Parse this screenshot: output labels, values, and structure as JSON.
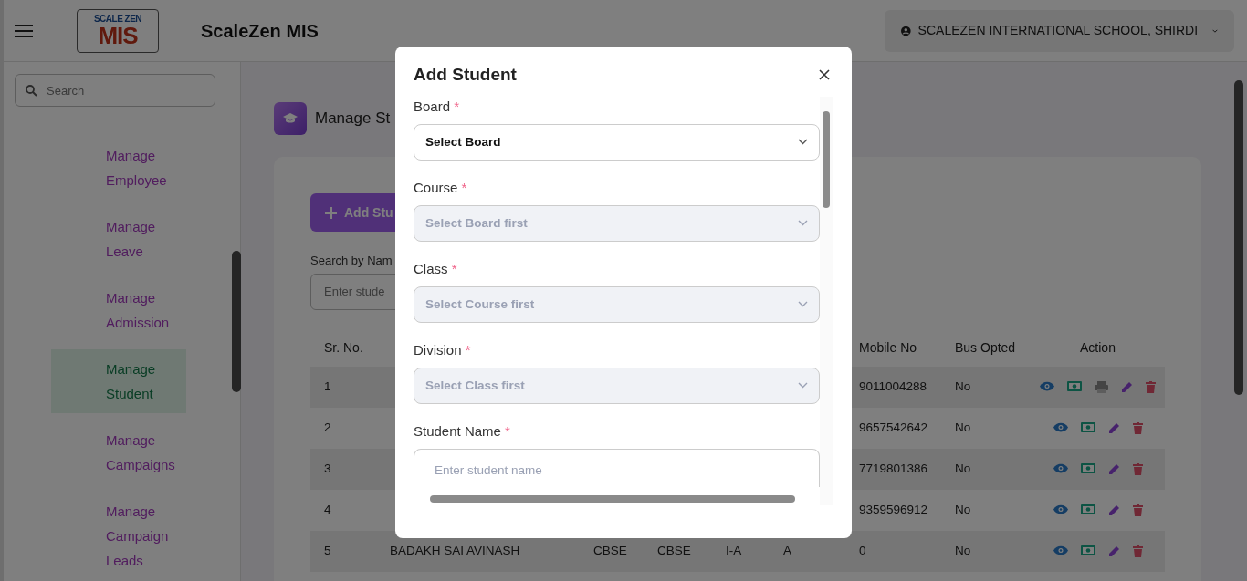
{
  "header": {
    "logo": {
      "top": "SCALE ZEN",
      "main": "MIS"
    },
    "title": "ScaleZen MIS",
    "school": "SCALEZEN INTERNATIONAL SCHOOL, SHIRDI"
  },
  "sidebar": {
    "search": {
      "placeholder": "Search"
    },
    "items": [
      {
        "label": "Manage Employee",
        "selected": false
      },
      {
        "label": "Manage Leave",
        "selected": false
      },
      {
        "label": "Manage Admission",
        "selected": false
      },
      {
        "label": "Manage Student",
        "selected": true
      },
      {
        "label": "Manage Campaigns",
        "selected": false
      },
      {
        "label": "Manage Campaign Leads",
        "selected": false
      }
    ]
  },
  "page": {
    "title": "Manage St",
    "add_button": "Add Stu",
    "search_label": "Search by Nam",
    "search": {
      "placeholder": "Enter stude"
    },
    "table": {
      "columns": [
        "Sr. No.",
        "Mobile No",
        "Bus Opted",
        "Action"
      ],
      "rows": [
        {
          "cells": [
            "1"
          ],
          "tail": [
            "9011004288",
            "No"
          ],
          "actions": [
            {
              "kind": "view"
            },
            {
              "kind": "fee"
            },
            {
              "kind": "print"
            },
            {
              "kind": "edit"
            },
            {
              "kind": "delete"
            }
          ]
        },
        {
          "cells": [
            "2"
          ],
          "tail": [
            "9657542642",
            "No"
          ],
          "actions": [
            {
              "kind": "view"
            },
            {
              "kind": "fee"
            },
            {
              "kind": "edit"
            },
            {
              "kind": "delete"
            }
          ]
        },
        {
          "cells": [
            "3"
          ],
          "tail": [
            "7719801386",
            "No"
          ],
          "actions": [
            {
              "kind": "view"
            },
            {
              "kind": "fee"
            },
            {
              "kind": "edit"
            },
            {
              "kind": "delete"
            }
          ]
        },
        {
          "cells": [
            "4"
          ],
          "tail": [
            "9359596912",
            "No"
          ],
          "actions": [
            {
              "kind": "view"
            },
            {
              "kind": "fee"
            },
            {
              "kind": "edit"
            },
            {
              "kind": "delete"
            }
          ]
        },
        {
          "cells": [
            "5",
            "BADAKH SAI AVINASH",
            "CBSE",
            "CBSE",
            "I-A",
            "A"
          ],
          "tail": [
            "0",
            "No"
          ],
          "actions": [
            {
              "kind": "view"
            },
            {
              "kind": "fee"
            },
            {
              "kind": "edit"
            },
            {
              "kind": "delete"
            }
          ]
        }
      ]
    }
  },
  "modal": {
    "title": "Add Student",
    "fields": [
      {
        "kind": "select",
        "label": "Board",
        "mark": "*",
        "value": "Select Board",
        "disabled": false
      },
      {
        "kind": "select",
        "label": "Course",
        "mark": "*",
        "placeholder": "Select Board first",
        "disabled": true
      },
      {
        "kind": "select",
        "label": "Class",
        "mark": "*",
        "placeholder": "Select Course first",
        "disabled": true
      },
      {
        "kind": "select",
        "label": "Division",
        "mark": "*",
        "placeholder": "Select Class first",
        "disabled": true
      },
      {
        "kind": "text",
        "label": "Student Name",
        "mark": "*",
        "placeholder": "Enter student name"
      }
    ]
  }
}
